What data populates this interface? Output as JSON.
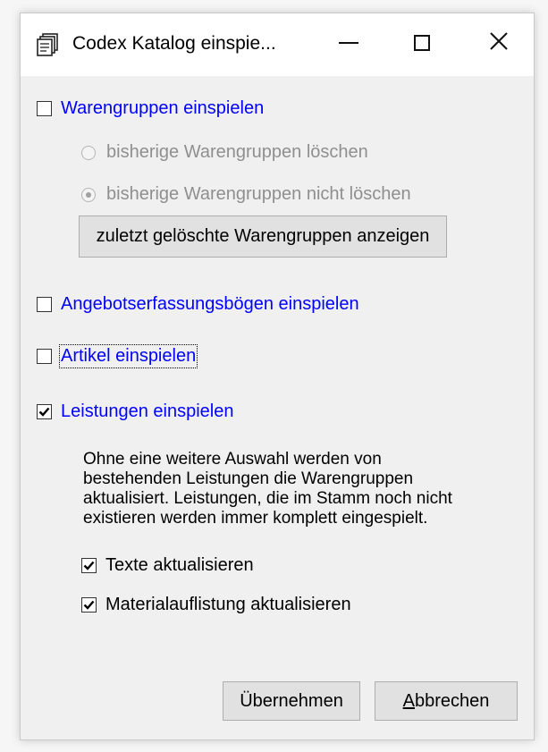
{
  "window": {
    "title": "Codex Katalog einspie...",
    "icon": "catalog-stack-icon"
  },
  "titlebar_buttons": {
    "minimize": "minimize-icon",
    "maximize": "maximize-icon",
    "close": "close-icon"
  },
  "warengruppen": {
    "label": "Warengruppen einspielen",
    "checked": false,
    "radio_delete": "bisherige Warengruppen löschen",
    "radio_keep": "bisherige Warengruppen nicht löschen",
    "radio_selected": "keep",
    "show_deleted_button": "zuletzt gelöschte Warengruppen anzeigen"
  },
  "angebot": {
    "label": "Angebotserfassungsbögen einspielen",
    "checked": false
  },
  "artikel": {
    "label": "Artikel einspielen",
    "checked": false
  },
  "leistungen": {
    "label": "Leistungen einspielen",
    "checked": true,
    "info_lines": [
      "Ohne eine weitere Auswahl werden von",
      "bestehenden Leistungen die Warengruppen",
      "aktualisiert. Leistungen, die im Stamm noch nicht",
      "existieren werden immer komplett eingespielt."
    ],
    "texte_label": "Texte aktualisieren",
    "texte_checked": true,
    "material_label": "Materialauflistung aktualisieren",
    "material_checked": true
  },
  "footer": {
    "ok_label": "Übernehmen",
    "cancel_prefix": "A",
    "cancel_rest": "bbrechen"
  },
  "colors": {
    "link_blue": "#0000ff",
    "disabled_gray": "#8f8f8f",
    "dialog_bg": "#f0f0f0"
  }
}
